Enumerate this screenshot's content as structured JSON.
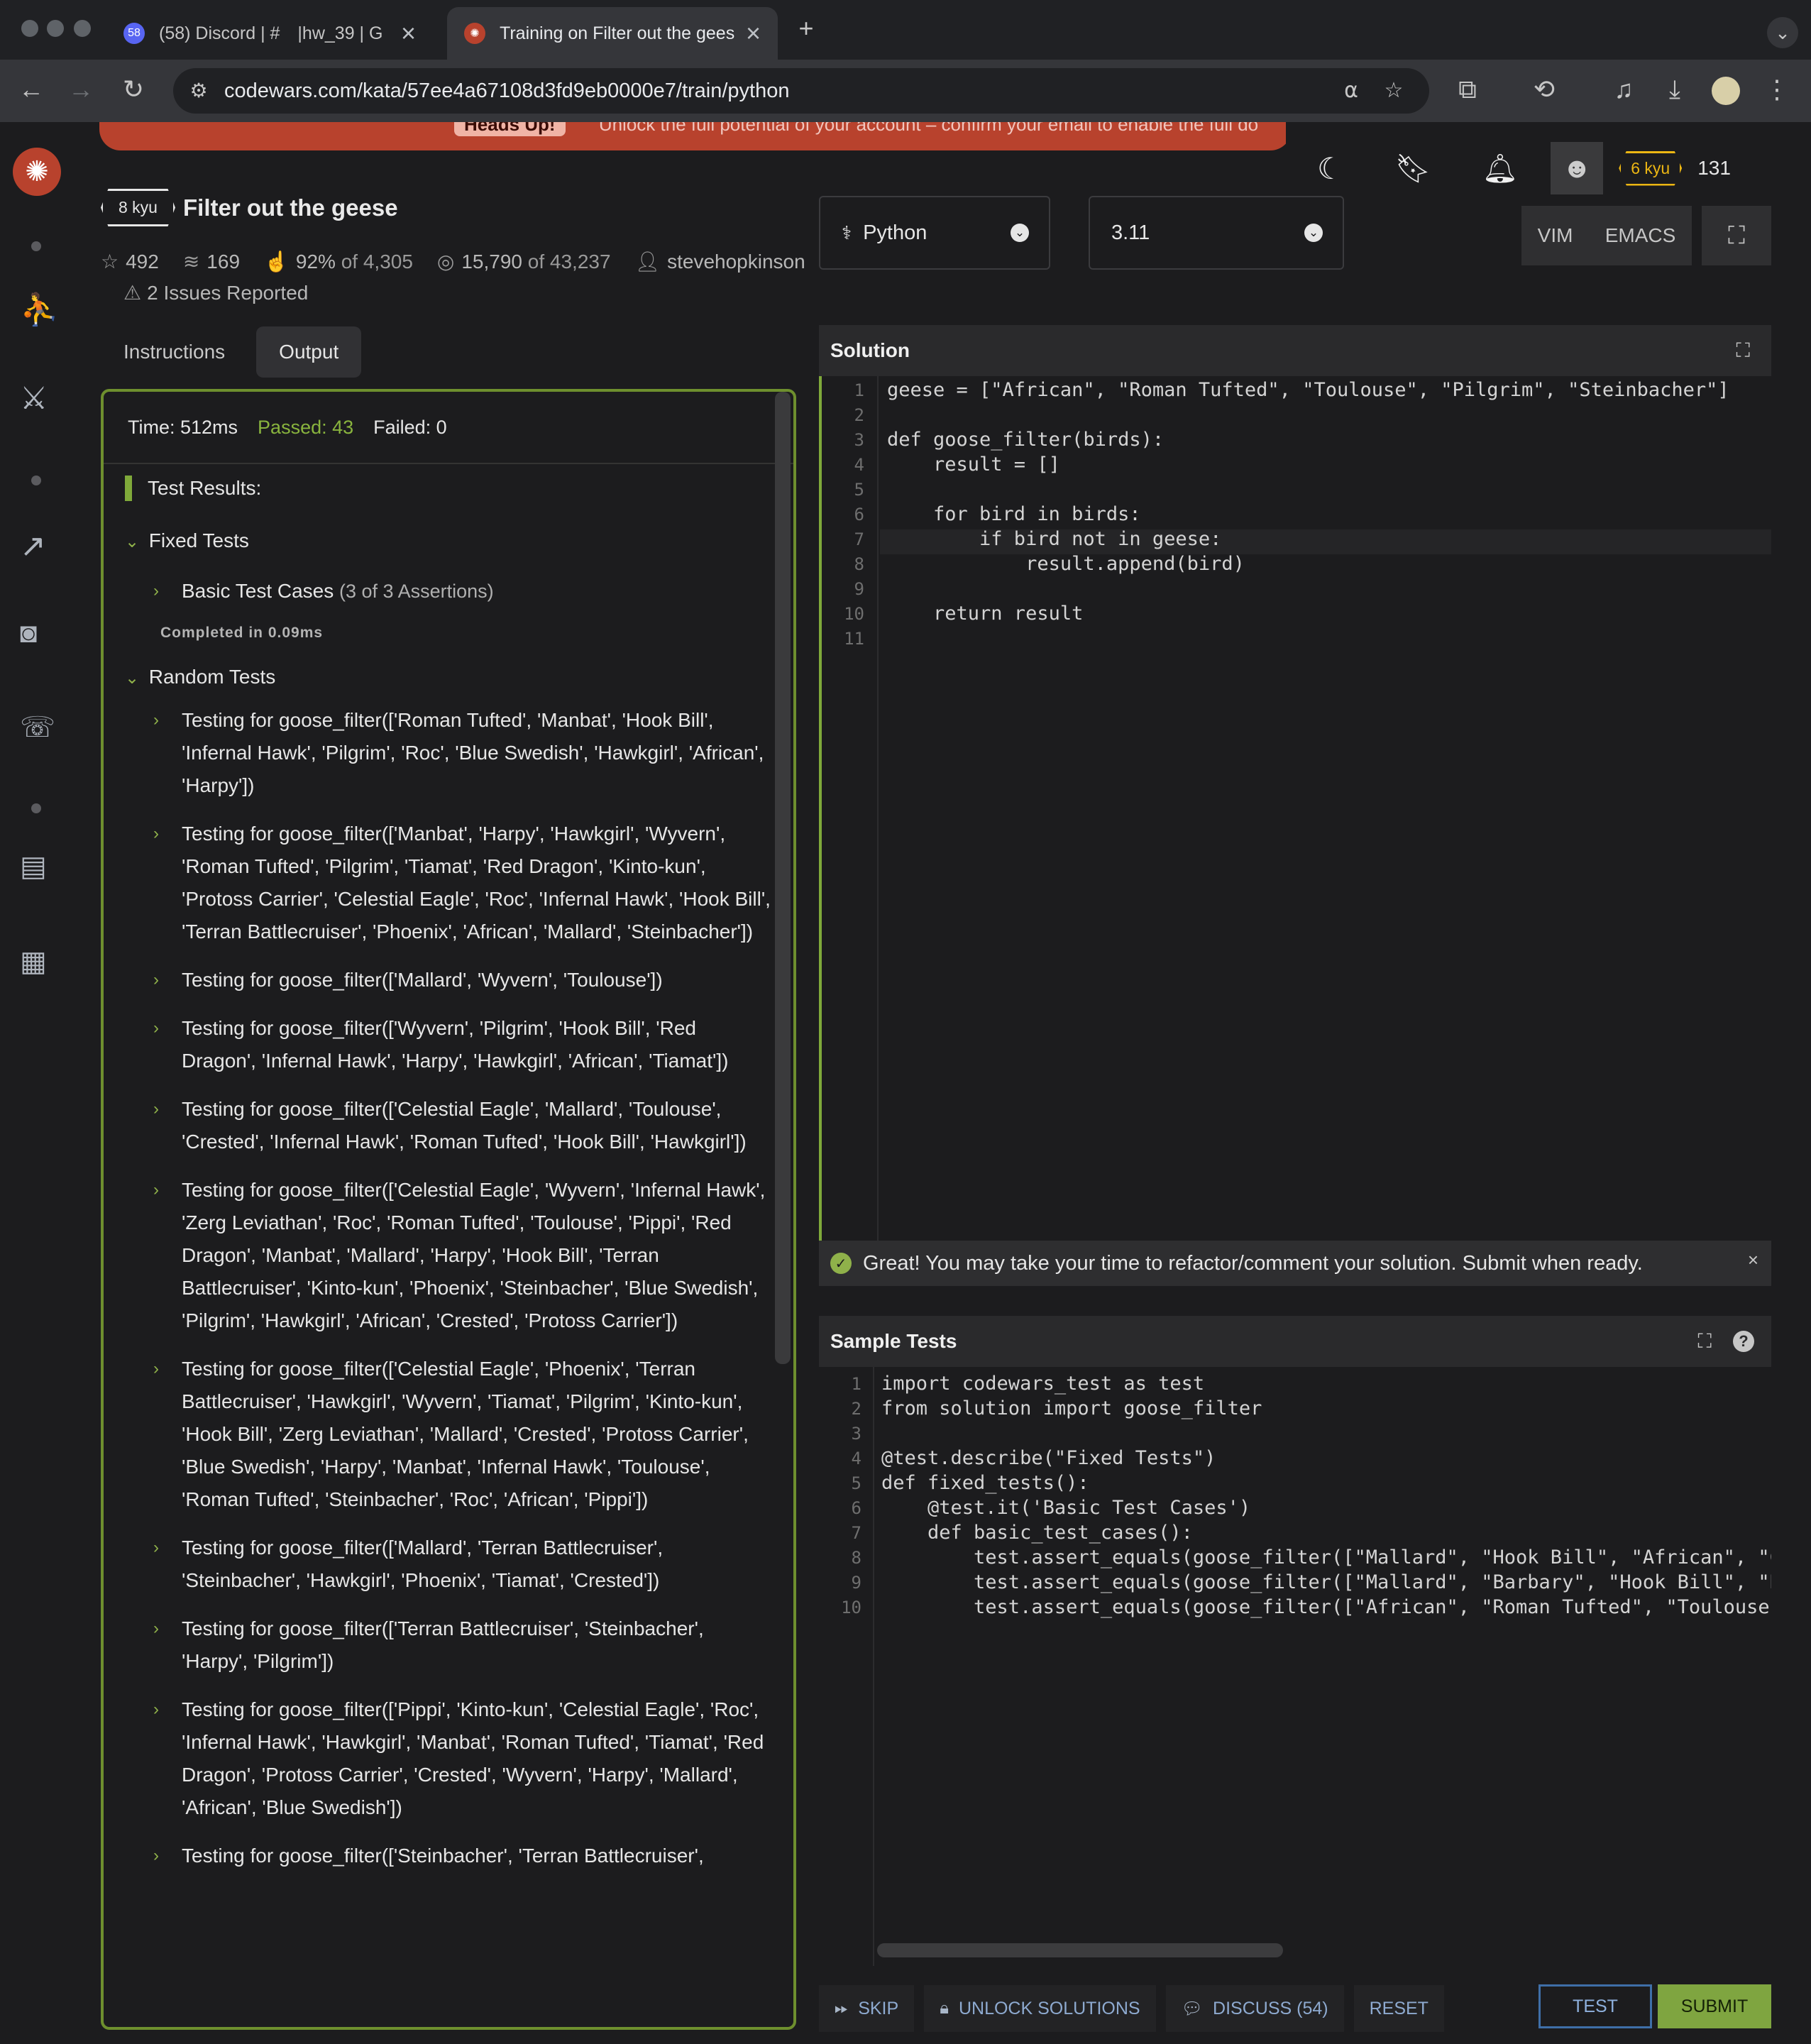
{
  "browser": {
    "tabs": [
      {
        "title": "(58) Discord | # |hw_39 | G",
        "badge": "58"
      },
      {
        "title": "Training on Filter out the gees"
      }
    ],
    "new_tab": "+",
    "url": "codewars.com/kata/57ee4a67108d3fd9eb0000e7/train/python"
  },
  "banner": {
    "label": "Heads Up!",
    "text": "Unlock the full potential of your account – confirm your email to enable the full do"
  },
  "user": {
    "rank": "6 kyu",
    "honor": "131"
  },
  "kata": {
    "rank": "8 kyu",
    "title": "Filter out the geese",
    "stars": "492",
    "collections": "169",
    "satisfaction": "92%",
    "satisfaction_of": "of 4,305",
    "completed": "15,790",
    "completed_of": "of 43,237",
    "author": "stevehopkinson",
    "issues": "2 Issues Reported"
  },
  "left_tabs": [
    "Instructions",
    "Output"
  ],
  "output": {
    "time": "Time: 512ms",
    "passed": "Passed: 43",
    "failed": "Failed: 0",
    "results_title": "Test Results:",
    "fixed_group": "Fixed Tests",
    "basic_case": "Basic Test Cases",
    "basic_case_count": "(3 of 3 Assertions)",
    "completed": "Completed in 0.09ms",
    "random_group": "Random Tests",
    "random_cases": [
      "Testing for goose_filter(['Roman Tufted', 'Manbat', 'Hook Bill', 'Infernal Hawk', 'Pilgrim', 'Roc', 'Blue Swedish', 'Hawkgirl', 'African', 'Harpy'])",
      "Testing for goose_filter(['Manbat', 'Harpy', 'Hawkgirl', 'Wyvern', 'Roman Tufted', 'Pilgrim', 'Tiamat', 'Red Dragon', 'Kinto-kun', 'Protoss Carrier', 'Celestial Eagle', 'Roc', 'Infernal Hawk', 'Hook Bill', 'Terran Battlecruiser', 'Phoenix', 'African', 'Mallard', 'Steinbacher'])",
      "Testing for goose_filter(['Mallard', 'Wyvern', 'Toulouse'])",
      "Testing for goose_filter(['Wyvern', 'Pilgrim', 'Hook Bill', 'Red Dragon', 'Infernal Hawk', 'Harpy', 'Hawkgirl', 'African', 'Tiamat'])",
      "Testing for goose_filter(['Celestial Eagle', 'Mallard', 'Toulouse', 'Crested', 'Infernal Hawk', 'Roman Tufted', 'Hook Bill', 'Hawkgirl'])",
      "Testing for goose_filter(['Celestial Eagle', 'Wyvern', 'Infernal Hawk', 'Zerg Leviathan', 'Roc', 'Roman Tufted', 'Toulouse', 'Pippi', 'Red Dragon', 'Manbat', 'Mallard', 'Harpy', 'Hook Bill', 'Terran Battlecruiser', 'Kinto-kun', 'Phoenix', 'Steinbacher', 'Blue Swedish', 'Pilgrim', 'Hawkgirl', 'African', 'Crested', 'Protoss Carrier'])",
      "Testing for goose_filter(['Celestial Eagle', 'Phoenix', 'Terran Battlecruiser', 'Hawkgirl', 'Wyvern', 'Tiamat', 'Pilgrim', 'Kinto-kun', 'Hook Bill', 'Zerg Leviathan', 'Mallard', 'Crested', 'Protoss Carrier', 'Blue Swedish', 'Harpy', 'Manbat', 'Infernal Hawk', 'Toulouse', 'Roman Tufted', 'Steinbacher', 'Roc', 'African', 'Pippi'])",
      "Testing for goose_filter(['Mallard', 'Terran Battlecruiser', 'Steinbacher', 'Hawkgirl', 'Phoenix', 'Tiamat', 'Crested'])",
      "Testing for goose_filter(['Terran Battlecruiser', 'Steinbacher', 'Harpy', 'Pilgrim'])",
      "Testing for goose_filter(['Pippi', 'Kinto-kun', 'Celestial Eagle', 'Roc', 'Infernal Hawk', 'Hawkgirl', 'Manbat', 'Roman Tufted', 'Tiamat', 'Red Dragon', 'Protoss Carrier', 'Crested', 'Wyvern', 'Harpy', 'Mallard', 'African', 'Blue Swedish'])",
      "Testing for goose_filter(['Steinbacher', 'Terran Battlecruiser',"
    ]
  },
  "language": {
    "name": "Python",
    "version": "3.11"
  },
  "editor_modes": [
    "VIM",
    "EMACS"
  ],
  "solution": {
    "title": "Solution",
    "lines": [
      "geese = [\"African\", \"Roman Tufted\", \"Toulouse\", \"Pilgrim\", \"Steinbacher\"]",
      "",
      "def goose_filter(birds):",
      "    result = []",
      "",
      "    for bird in birds:",
      "        if bird not in geese:",
      "            result.append(bird)",
      "",
      "    return result",
      ""
    ]
  },
  "notice": "Great! You may take your time to refactor/comment your solution. Submit when ready.",
  "sample_tests": {
    "title": "Sample Tests",
    "lines": [
      "import codewars_test as test",
      "from solution import goose_filter",
      "",
      "@test.describe(\"Fixed Tests\")",
      "def fixed_tests():",
      "    @test.it('Basic Test Cases')",
      "    def basic_test_cases():",
      "        test.assert_equals(goose_filter([\"Mallard\", \"Hook Bill\", \"African\", \"Crest",
      "        test.assert_equals(goose_filter([\"Mallard\", \"Barbary\", \"Hook Bill\", \"Blue",
      "        test.assert_equals(goose_filter([\"African\", \"Roman Tufted\", \"Toulouse\", \"P"
    ]
  },
  "actions": {
    "skip": "SKIP",
    "unlock": "UNLOCK SOLUTIONS",
    "discuss": "DISCUSS (54)",
    "reset": "RESET",
    "test": "TEST",
    "submit": "SUBMIT"
  },
  "colors": {
    "accent_green": "#7fa540",
    "brand_red": "#b8422d",
    "rank_yellow": "#ecb613"
  }
}
